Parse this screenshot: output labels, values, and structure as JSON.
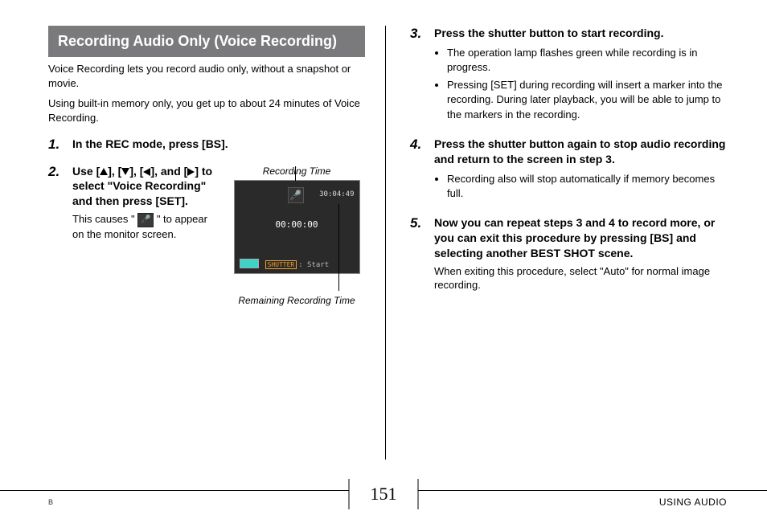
{
  "section_title": "Recording Audio Only (Voice Recording)",
  "intro1": "Voice Recording lets you record audio only, without a snapshot or movie.",
  "intro2": "Using built-in memory only, you get up to about 24 minutes of Voice Recording.",
  "step1": {
    "num": "1.",
    "title": "In the REC mode, press [BS]."
  },
  "step2": {
    "num": "2.",
    "title_pre": "Use [",
    "title_mid1": "], [",
    "title_mid2": "], [",
    "title_mid3": "], and [",
    "title_post": "] to select \"Voice Recording\" and then press [SET].",
    "note_pre": "This causes \" ",
    "note_post": " \" to appear on the monitor screen.",
    "caption_top": "Recording Time",
    "caption_bottom": "Remaining Recording Time",
    "lcd": {
      "remain": "30:04:49",
      "elapsed": "00:00:00",
      "shutter_label": "SHUTTER",
      "start": ": Start"
    }
  },
  "step3": {
    "num": "3.",
    "title": "Press the shutter button to start recording.",
    "bullets": [
      "The operation lamp flashes green while recording is in progress.",
      "Pressing [SET] during recording will insert a marker into the recording. During later playback, you will be able to jump to the markers in the recording."
    ]
  },
  "step4": {
    "num": "4.",
    "title": "Press the shutter button again to stop audio recording and return to the screen in step 3.",
    "bullets": [
      "Recording also will stop automatically if memory becomes full."
    ]
  },
  "step5": {
    "num": "5.",
    "title": "Now you can repeat steps 3 and 4 to record more, or you can exit this procedure by pressing [BS] and selecting another BEST SHOT scene.",
    "note": "When exiting this procedure, select \"Auto\" for normal image recording."
  },
  "footer": {
    "left": "B",
    "right": "USING AUDIO",
    "page": "151"
  }
}
